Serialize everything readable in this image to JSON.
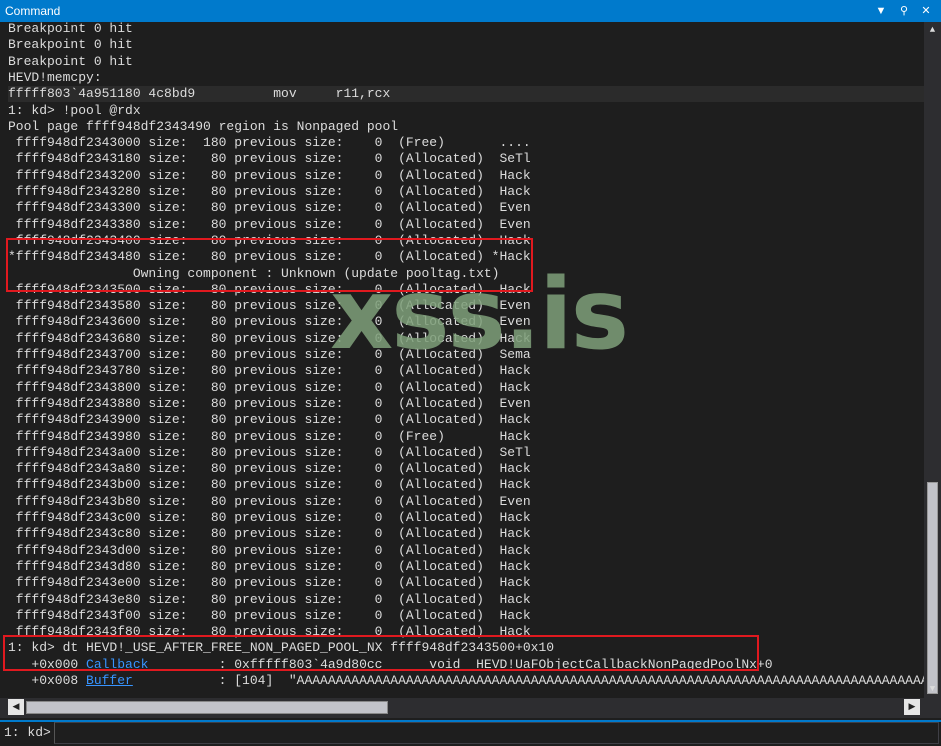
{
  "window": {
    "title": "Command"
  },
  "output": {
    "lines": [
      "Breakpoint 0 hit",
      "Breakpoint 0 hit",
      "Breakpoint 0 hit",
      "HEVD!memcpy:",
      "fffff803`4a951180 4c8bd9          mov     r11,rcx",
      "1: kd> !pool @rdx",
      "Pool page ffff948df2343490 region is Nonpaged pool",
      " ffff948df2343000 size:  180 previous size:    0  (Free)       ....",
      " ffff948df2343180 size:   80 previous size:    0  (Allocated)  SeTl",
      " ffff948df2343200 size:   80 previous size:    0  (Allocated)  Hack",
      " ffff948df2343280 size:   80 previous size:    0  (Allocated)  Hack",
      " ffff948df2343300 size:   80 previous size:    0  (Allocated)  Even",
      " ffff948df2343380 size:   80 previous size:    0  (Allocated)  Even",
      " ffff948df2343400 size:   80 previous size:    0  (Allocated)  Hack",
      "*ffff948df2343480 size:   80 previous size:    0  (Allocated) *Hack",
      "\t\tOwning component : Unknown (update pooltag.txt)",
      " ffff948df2343500 size:   80 previous size:    0  (Allocated)  Hack",
      " ffff948df2343580 size:   80 previous size:    0  (Allocated)  Even",
      " ffff948df2343600 size:   80 previous size:    0  (Allocated)  Even",
      " ffff948df2343680 size:   80 previous size:    0  (Allocated)  Hack",
      " ffff948df2343700 size:   80 previous size:    0  (Allocated)  Sema",
      " ffff948df2343780 size:   80 previous size:    0  (Allocated)  Hack",
      " ffff948df2343800 size:   80 previous size:    0  (Allocated)  Hack",
      " ffff948df2343880 size:   80 previous size:    0  (Allocated)  Even",
      " ffff948df2343900 size:   80 previous size:    0  (Allocated)  Hack",
      " ffff948df2343980 size:   80 previous size:    0  (Free)       Hack",
      " ffff948df2343a00 size:   80 previous size:    0  (Allocated)  SeTl",
      " ffff948df2343a80 size:   80 previous size:    0  (Allocated)  Hack",
      " ffff948df2343b00 size:   80 previous size:    0  (Allocated)  Hack",
      " ffff948df2343b80 size:   80 previous size:    0  (Allocated)  Even",
      " ffff948df2343c00 size:   80 previous size:    0  (Allocated)  Hack",
      " ffff948df2343c80 size:   80 previous size:    0  (Allocated)  Hack",
      " ffff948df2343d00 size:   80 previous size:    0  (Allocated)  Hack",
      " ffff948df2343d80 size:   80 previous size:    0  (Allocated)  Hack",
      " ffff948df2343e00 size:   80 previous size:    0  (Allocated)  Hack",
      " ffff948df2343e80 size:   80 previous size:    0  (Allocated)  Hack",
      " ffff948df2343f00 size:   80 previous size:    0  (Allocated)  Hack",
      " ffff948df2343f80 size:   80 previous size:    0  (Allocated)  Hack",
      "1: kd> dt HEVD!_USE_AFTER_FREE_NON_PAGED_POOL_NX ffff948df2343500+0x10"
    ],
    "struct_rows": [
      {
        "offset": "   +0x000 ",
        "field": "Callback",
        "value": "         : 0xfffff803`4a9d80cc      void  HEVD!UaFObjectCallbackNonPagedPoolNx+0"
      },
      {
        "offset": "   +0x008 ",
        "field": "Buffer",
        "value": "           : [104]  \"AAAAAAAAAAAAAAAAAAAAAAAAAAAAAAAAAAAAAAAAAAAAAAAAAAAAAAAAAAAAAAAAAAAAAAAAAAAAAAAAAAAAAA"
      }
    ]
  },
  "watermark": {
    "text": "xss.is"
  },
  "command": {
    "prompt": "1: kd>",
    "value": ""
  },
  "icons": {
    "dropdown": "chevron-down-icon",
    "pin": "pin-icon",
    "close": "close-icon"
  },
  "colors": {
    "accent": "#007acc",
    "highlight_box": "#e0191f",
    "link": "#3794ff",
    "watermark": "#7fa07a"
  }
}
